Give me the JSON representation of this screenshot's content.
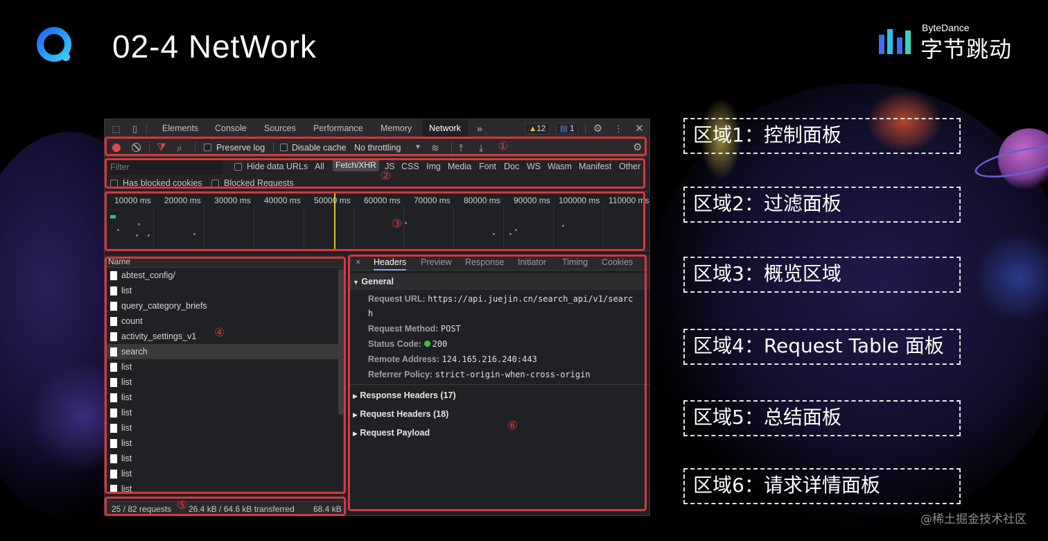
{
  "slide": {
    "title": "02-4 NetWork",
    "brand_en": "ByteDance",
    "brand_cn": "字节跳动",
    "watermark": "@稀土掘金技术社区"
  },
  "devtools": {
    "tabs": [
      "Elements",
      "Console",
      "Sources",
      "Performance",
      "Memory",
      "Network"
    ],
    "active_tab": "Network",
    "more_tabs": "»",
    "warnings_count": "12",
    "messages_count": "1",
    "toolbar": {
      "preserve_log": "Preserve log",
      "disable_cache": "Disable cache",
      "throttling": "No throttling"
    },
    "filter": {
      "placeholder": "Filter",
      "hide_data_urls": "Hide data URLs",
      "types": [
        "All",
        "Fetch/XHR",
        "JS",
        "CSS",
        "Img",
        "Media",
        "Font",
        "Doc",
        "WS",
        "Wasm",
        "Manifest",
        "Other"
      ],
      "active_type": "Fetch/XHR",
      "has_blocked_cookies": "Has blocked cookies",
      "blocked_requests": "Blocked Requests"
    },
    "overview_ticks": [
      "10000 ms",
      "20000 ms",
      "30000 ms",
      "40000 ms",
      "50000 ms",
      "60000 ms",
      "70000 ms",
      "80000 ms",
      "90000 ms",
      "100000 ms",
      "110000 ms"
    ],
    "request_table": {
      "column": "Name",
      "rows": [
        "abtest_config/",
        "list",
        "query_category_briefs",
        "count",
        "activity_settings_v1",
        "search",
        "list",
        "list",
        "list",
        "list",
        "list",
        "list",
        "list",
        "list",
        "list"
      ],
      "selected": "search"
    },
    "summary": {
      "requests": "25 / 82 requests",
      "transferred": "26.4 kB / 64.6 kB transferred",
      "resources": "68.4 kB"
    },
    "detail": {
      "close": "×",
      "tabs": [
        "Headers",
        "Preview",
        "Response",
        "Initiator",
        "Timing",
        "Cookies"
      ],
      "active_tab": "Headers",
      "general_title": "General",
      "general": [
        {
          "key": "Request URL:",
          "value": "https://api.juejin.cn/search_api/v1/searc"
        },
        {
          "key": "",
          "value": "h"
        },
        {
          "key": "Request Method:",
          "value": "POST"
        },
        {
          "key": "Status Code:",
          "value": "200"
        },
        {
          "key": "Remote Address:",
          "value": "124.165.216.240:443"
        },
        {
          "key": "Referrer Policy:",
          "value": "strict-origin-when-cross-origin"
        }
      ],
      "sections": [
        "Response Headers (17)",
        "Request Headers (18)",
        "Request Payload"
      ]
    }
  },
  "annotations": [
    "①",
    "②",
    "③",
    "④",
    "⑤",
    "⑥"
  ],
  "regions": [
    "区域1：控制面板",
    "区域2：过滤面板",
    "区域3：概览区域",
    "区域4：Request Table 面板",
    "区域5：总结面板",
    "区域6：请求详情面板"
  ],
  "colors": {
    "annotation_red": "#d9363e",
    "record_red": "#e0484a",
    "status_green": "#3cc43c",
    "timeline_marker": "#e2c62b"
  }
}
